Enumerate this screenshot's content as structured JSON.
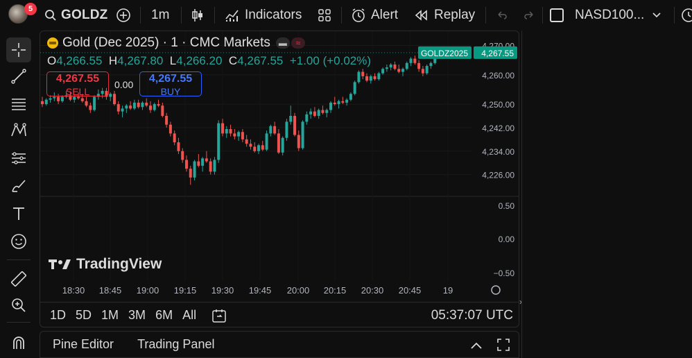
{
  "topbar": {
    "notification_count": "5",
    "symbol": "GOLDZ",
    "interval": "1m",
    "indicators_label": "Indicators",
    "alert_label": "Alert",
    "replay_label": "Replay",
    "compare_symbol": "NASD100..."
  },
  "legend": {
    "title": "Gold (Dec 2025)",
    "interval": "1",
    "exchange": "CMC Markets",
    "o_label": "O",
    "o": "4,266.55",
    "h_label": "H",
    "h": "4,267.80",
    "l_label": "L",
    "l": "4,266.20",
    "c_label": "C",
    "c": "4,267.55",
    "change": "+1.00 (+0.02%)"
  },
  "trade": {
    "sell_price": "4,267.55",
    "sell_label": "SELL",
    "buy_price": "4,267.55",
    "buy_label": "BUY",
    "spread": "0.00"
  },
  "price_axis": {
    "labels": [
      "4,270.00",
      "4,260.00",
      "4,250.00",
      "4,242.00",
      "4,234.00",
      "4,226.00"
    ],
    "current_symbol_tag": "GOLDZ2025",
    "current_price_tag": "4,267.55"
  },
  "indicator_axis": {
    "labels": [
      "0.50",
      "0.00",
      "−0.50"
    ]
  },
  "time_axis": {
    "labels": [
      "18:30",
      "18:45",
      "19:00",
      "19:15",
      "19:30",
      "19:45",
      "20:00",
      "20:15",
      "20:30",
      "20:45",
      "19"
    ]
  },
  "watermark": "TradingView",
  "range_bar": {
    "ranges": [
      "1D",
      "5D",
      "1M",
      "3M",
      "6M",
      "All"
    ],
    "clock": "05:37:07 UTC"
  },
  "bottom_panel": {
    "pine_editor": "Pine Editor",
    "trading_panel": "Trading Panel"
  },
  "colors": {
    "up": "#26a69a",
    "down": "#ef5350",
    "accent": "#2962ff",
    "tag_bg": "#089981"
  },
  "chart_data": {
    "type": "candlestick",
    "title": "Gold (Dec 2025)",
    "ylim": [
      4220,
      4272
    ],
    "ohlc": [
      [
        4251.0,
        4252.5,
        4249.0,
        4250.0
      ],
      [
        4250.0,
        4252.0,
        4249.5,
        4251.5
      ],
      [
        4251.5,
        4253.0,
        4250.5,
        4252.0
      ],
      [
        4252.0,
        4254.0,
        4251.0,
        4252.5
      ],
      [
        4252.5,
        4253.5,
        4250.0,
        4251.0
      ],
      [
        4251.0,
        4253.0,
        4250.5,
        4252.5
      ],
      [
        4252.5,
        4254.5,
        4252.0,
        4253.0
      ],
      [
        4253.0,
        4254.0,
        4251.0,
        4251.5
      ],
      [
        4251.5,
        4253.0,
        4250.5,
        4252.5
      ],
      [
        4252.5,
        4254.0,
        4251.5,
        4252.0
      ],
      [
        4252.0,
        4253.5,
        4250.5,
        4251.0
      ],
      [
        4251.0,
        4252.5,
        4249.0,
        4249.5
      ],
      [
        4249.5,
        4250.5,
        4247.0,
        4248.0
      ],
      [
        4248.0,
        4253.0,
        4247.5,
        4252.5
      ],
      [
        4252.5,
        4255.0,
        4251.5,
        4253.5
      ],
      [
        4253.5,
        4255.5,
        4252.0,
        4254.5
      ],
      [
        4254.5,
        4255.5,
        4251.5,
        4252.5
      ],
      [
        4252.5,
        4254.0,
        4251.0,
        4253.5
      ],
      [
        4253.5,
        4254.5,
        4249.5,
        4250.0
      ],
      [
        4250.0,
        4251.0,
        4246.5,
        4247.5
      ],
      [
        4247.5,
        4249.5,
        4245.5,
        4248.5
      ],
      [
        4248.5,
        4250.0,
        4247.0,
        4249.5
      ],
      [
        4249.5,
        4251.0,
        4248.0,
        4248.5
      ],
      [
        4248.5,
        4251.5,
        4248.0,
        4250.5
      ],
      [
        4250.5,
        4251.5,
        4248.5,
        4249.0
      ],
      [
        4249.0,
        4251.0,
        4248.0,
        4250.5
      ],
      [
        4250.5,
        4252.0,
        4249.0,
        4249.5
      ],
      [
        4249.5,
        4251.0,
        4247.0,
        4248.0
      ],
      [
        4248.0,
        4250.5,
        4247.5,
        4250.0
      ],
      [
        4250.0,
        4251.5,
        4249.0,
        4249.5
      ],
      [
        4249.5,
        4250.5,
        4245.5,
        4246.0
      ],
      [
        4246.0,
        4247.0,
        4242.0,
        4243.0
      ],
      [
        4243.0,
        4244.0,
        4239.0,
        4240.0
      ],
      [
        4240.0,
        4241.0,
        4236.0,
        4237.0
      ],
      [
        4237.0,
        4238.5,
        4233.0,
        4234.0
      ],
      [
        4234.0,
        4235.0,
        4230.0,
        4231.0
      ],
      [
        4231.0,
        4232.5,
        4227.0,
        4228.0
      ],
      [
        4228.0,
        4229.0,
        4222.5,
        4225.0
      ],
      [
        4225.0,
        4231.0,
        4224.0,
        4230.5
      ],
      [
        4230.5,
        4233.0,
        4228.5,
        4229.0
      ],
      [
        4229.0,
        4232.0,
        4227.0,
        4231.5
      ],
      [
        4231.5,
        4234.0,
        4230.0,
        4230.5
      ],
      [
        4230.5,
        4231.5,
        4226.0,
        4227.0
      ],
      [
        4227.0,
        4232.0,
        4226.0,
        4231.0
      ],
      [
        4231.0,
        4244.5,
        4230.0,
        4243.5
      ],
      [
        4243.5,
        4245.0,
        4239.0,
        4240.0
      ],
      [
        4240.0,
        4242.5,
        4238.5,
        4241.5
      ],
      [
        4241.5,
        4243.0,
        4239.0,
        4240.0
      ],
      [
        4240.0,
        4241.5,
        4238.0,
        4239.0
      ],
      [
        4239.0,
        4241.0,
        4237.5,
        4240.5
      ],
      [
        4240.5,
        4241.5,
        4237.0,
        4238.0
      ],
      [
        4238.0,
        4239.5,
        4235.5,
        4236.5
      ],
      [
        4236.5,
        4238.0,
        4234.5,
        4235.5
      ],
      [
        4235.5,
        4237.0,
        4233.5,
        4234.0
      ],
      [
        4234.0,
        4236.5,
        4233.0,
        4236.0
      ],
      [
        4236.0,
        4237.5,
        4234.0,
        4234.5
      ],
      [
        4234.5,
        4241.0,
        4234.0,
        4240.0
      ],
      [
        4240.0,
        4243.0,
        4239.0,
        4242.5
      ],
      [
        4242.5,
        4244.0,
        4239.5,
        4240.0
      ],
      [
        4240.0,
        4241.5,
        4233.0,
        4233.5
      ],
      [
        4233.5,
        4239.0,
        4232.5,
        4238.5
      ],
      [
        4238.5,
        4245.0,
        4237.5,
        4244.0
      ],
      [
        4244.0,
        4249.5,
        4243.0,
        4246.0
      ],
      [
        4246.0,
        4247.0,
        4239.0,
        4239.5
      ],
      [
        4239.5,
        4241.0,
        4234.0,
        4235.0
      ],
      [
        4235.0,
        4244.5,
        4234.5,
        4244.0
      ],
      [
        4244.0,
        4247.5,
        4243.0,
        4246.5
      ],
      [
        4246.5,
        4248.5,
        4245.0,
        4247.5
      ],
      [
        4247.5,
        4249.0,
        4245.5,
        4246.0
      ],
      [
        4246.0,
        4248.5,
        4245.0,
        4248.0
      ],
      [
        4248.0,
        4249.5,
        4246.5,
        4247.0
      ],
      [
        4247.0,
        4248.5,
        4245.5,
        4248.0
      ],
      [
        4248.0,
        4251.0,
        4247.0,
        4250.5
      ],
      [
        4250.5,
        4252.5,
        4249.5,
        4250.0
      ],
      [
        4250.0,
        4251.5,
        4248.5,
        4251.0
      ],
      [
        4251.0,
        4252.5,
        4250.0,
        4250.5
      ],
      [
        4250.5,
        4252.0,
        4249.5,
        4251.5
      ],
      [
        4251.5,
        4254.0,
        4251.0,
        4253.5
      ],
      [
        4253.5,
        4258.0,
        4253.0,
        4257.5
      ],
      [
        4257.5,
        4261.5,
        4257.0,
        4261.0
      ],
      [
        4261.0,
        4262.0,
        4258.5,
        4259.5
      ],
      [
        4259.5,
        4260.5,
        4257.5,
        4258.0
      ],
      [
        4258.0,
        4260.0,
        4257.0,
        4259.5
      ],
      [
        4259.5,
        4260.5,
        4258.0,
        4258.5
      ],
      [
        4258.5,
        4261.0,
        4258.0,
        4260.5
      ],
      [
        4260.5,
        4262.5,
        4260.0,
        4262.0
      ],
      [
        4262.0,
        4263.5,
        4261.0,
        4262.5
      ],
      [
        4262.5,
        4264.0,
        4261.5,
        4263.5
      ],
      [
        4263.5,
        4264.5,
        4261.5,
        4262.0
      ],
      [
        4262.0,
        4263.5,
        4260.5,
        4261.0
      ],
      [
        4261.0,
        4262.5,
        4259.5,
        4262.0
      ],
      [
        4262.0,
        4264.5,
        4261.5,
        4264.0
      ],
      [
        4264.0,
        4266.0,
        4263.0,
        4265.5
      ],
      [
        4265.5,
        4266.5,
        4263.5,
        4264.0
      ],
      [
        4264.0,
        4265.0,
        4261.0,
        4262.0
      ],
      [
        4262.0,
        4263.0,
        4259.5,
        4260.5
      ],
      [
        4260.5,
        4263.5,
        4260.0,
        4263.0
      ],
      [
        4263.0,
        4264.5,
        4262.0,
        4264.0
      ],
      [
        4264.0,
        4266.5,
        4263.5,
        4266.5
      ],
      [
        4266.5,
        4267.8,
        4266.2,
        4267.55
      ]
    ]
  }
}
